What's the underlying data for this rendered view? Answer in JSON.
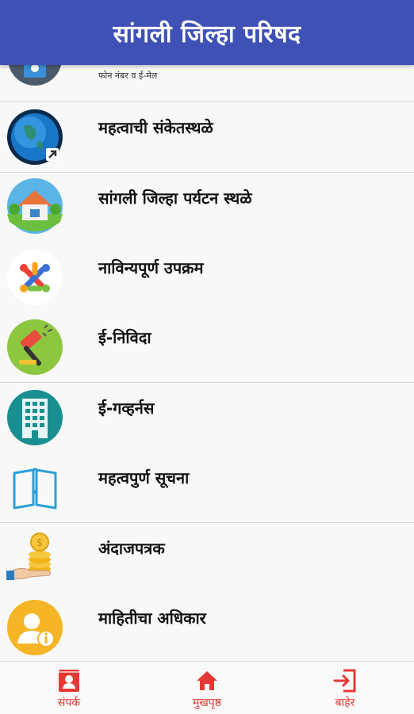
{
  "app": {
    "title": "सांगली जिल्हा परिषद"
  },
  "list": {
    "partial_item": {
      "subtitle": "फोन नंबर व ई-मेल",
      "icon": "contact-phone-icon"
    },
    "items": [
      {
        "label": "महत्वाची संकेतस्थळे",
        "icon": "globe-icon"
      },
      {
        "label": "सांगली जिल्हा पर्यटन स्थळे",
        "icon": "house-icon"
      },
      {
        "label": "नाविन्यपूर्ण उपक्रम",
        "icon": "puzzle-logo-icon"
      },
      {
        "label": "ई-निविदा",
        "icon": "gavel-icon"
      },
      {
        "label": "ई-गव्हर्नस",
        "icon": "building-icon"
      },
      {
        "label": "महत्वपुर्ण सूचना",
        "icon": "book-icon"
      },
      {
        "label": "अंदाजपत्रक",
        "icon": "coins-hand-icon"
      },
      {
        "label": "माहितीचा अधिकार",
        "icon": "user-info-icon"
      }
    ]
  },
  "bottom_nav": [
    {
      "label": "संपर्क",
      "icon": "contact-icon"
    },
    {
      "label": "मुखपृष्ठ",
      "icon": "home-icon"
    },
    {
      "label": "बाहेर",
      "icon": "exit-icon"
    }
  ],
  "colors": {
    "appbar": "#3f51b5",
    "nav_accent": "#e53935"
  }
}
